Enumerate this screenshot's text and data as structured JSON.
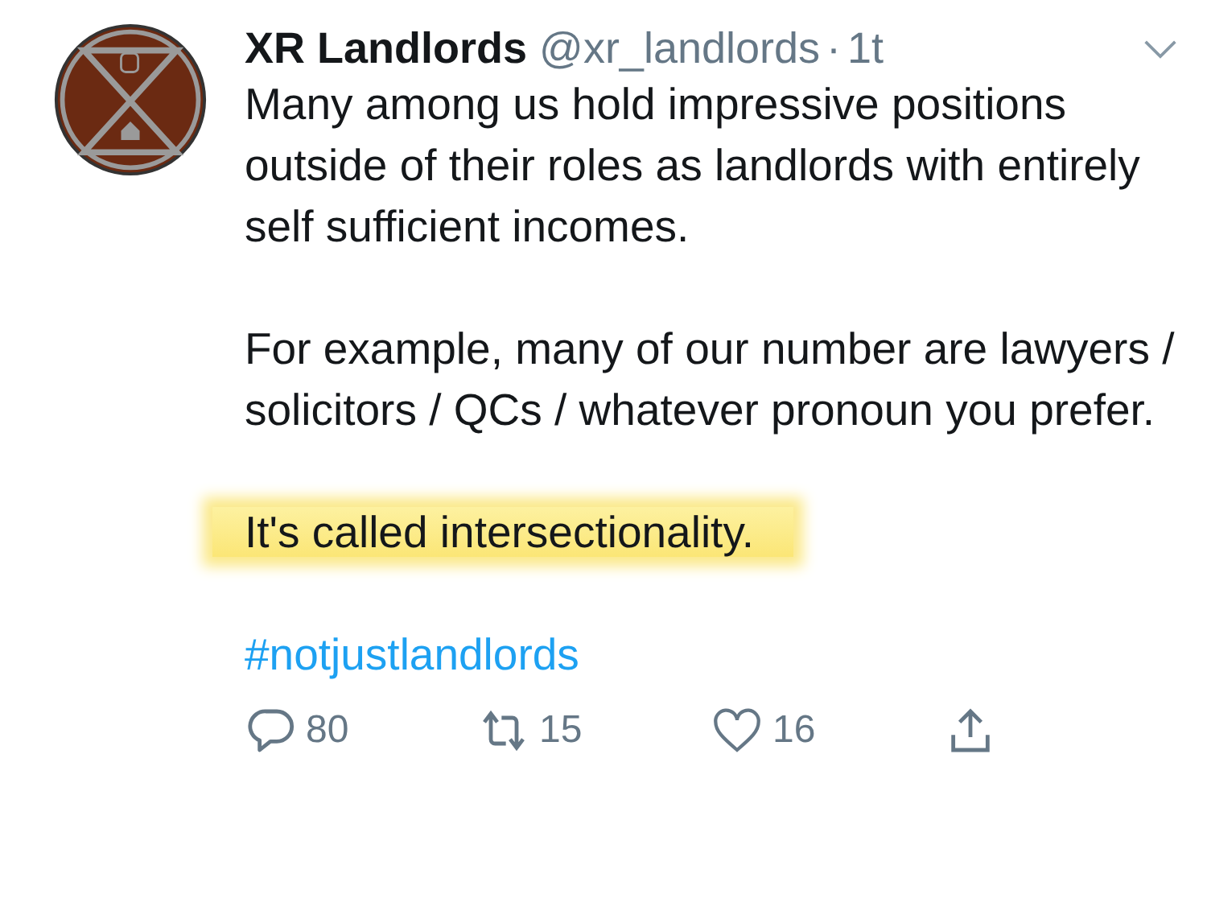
{
  "tweet": {
    "display_name": "XR Landlords",
    "handle": "@xr_landlords",
    "separator": "·",
    "time": "1t",
    "paragraphs": [
      {
        "text": "Many among us hold impressive positions outside of their roles as landlords with entirely self sufficient incomes.",
        "highlighted": false
      },
      {
        "text": "For example, many of our number are lawyers / solicitors / QCs / whatever pronoun you prefer.",
        "highlighted": false
      },
      {
        "text": "It's called intersectionality.",
        "highlighted": true
      }
    ],
    "hashtag": "#notjustlandlords",
    "actions": [
      {
        "kind": "reply",
        "count": "80"
      },
      {
        "kind": "retweet",
        "count": "15"
      },
      {
        "kind": "like",
        "count": "16"
      },
      {
        "kind": "share"
      }
    ]
  }
}
